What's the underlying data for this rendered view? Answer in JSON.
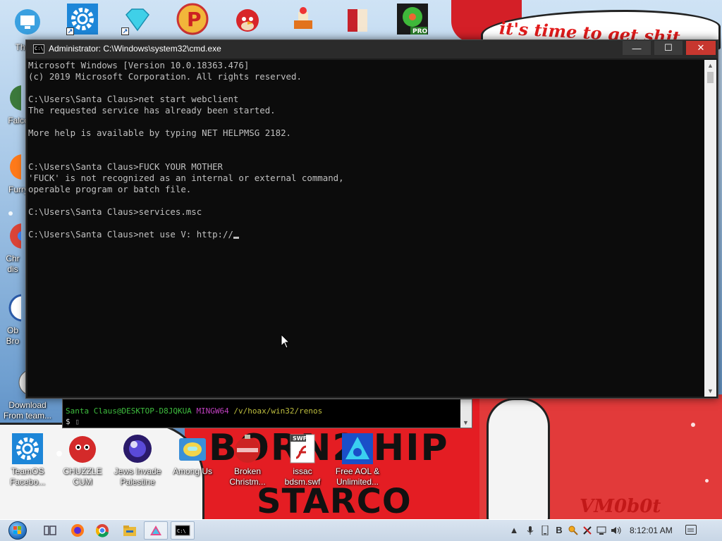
{
  "cmd_window": {
    "title": "Administrator: C:\\Windows\\system32\\cmd.exe",
    "icon_label": "C:\\",
    "lines": [
      "Microsoft Windows [Version 10.0.18363.476]",
      "(c) 2019 Microsoft Corporation. All rights reserved.",
      "",
      "C:\\Users\\Santa Claus>net start webclient",
      "The requested service has already been started.",
      "",
      "More help is available by typing NET HELPMSG 2182.",
      "",
      "",
      "C:\\Users\\Santa Claus>FUCK YOUR MOTHER",
      "'FUCK' is not recognized as an internal or external command,",
      "operable program or batch file.",
      "",
      "C:\\Users\\Santa Claus>services.msc",
      ""
    ],
    "current_input": "C:\\Users\\Santa Claus>net use V: http://",
    "buttons": {
      "minimize": "—",
      "maximize": "☐",
      "close": "✕"
    }
  },
  "git_bash": {
    "user_host": "Santa Claus@DESKTOP-D8JQKUA",
    "env": "MINGW64",
    "path": "/v/hoax/win32/renos",
    "prompt": "$"
  },
  "desktop_icons_left": [
    {
      "label": "Thi",
      "icon": "monitor-icon"
    },
    {
      "label": "Falco",
      "icon": "falcon-icon"
    },
    {
      "label": "Furry",
      "icon": "firefox-icon"
    },
    {
      "label": "Chr dis",
      "icon": "chrome-icon"
    },
    {
      "label": "Ob Bro",
      "icon": "obama-icon"
    },
    {
      "label": "Download From team...",
      "icon": "download-icon"
    }
  ],
  "desktop_icons_top": [
    {
      "icon": "gear-icon"
    },
    {
      "icon": "diamond-icon"
    },
    {
      "icon": "pinball-icon"
    },
    {
      "icon": "angry-bird-icon"
    },
    {
      "icon": "santa-ship-icon"
    },
    {
      "icon": "christmas-card-icon"
    },
    {
      "icon": "icq-flower-icon",
      "badge": "PRO"
    }
  ],
  "desktop_icons_bottom": [
    {
      "label": "TeamOS Facebo...",
      "icon": "gear-icon"
    },
    {
      "label": "CHUZZLE CUM",
      "icon": "chuzzle-icon"
    },
    {
      "label": "Jews Invade Palestine",
      "icon": "orb-icon"
    },
    {
      "label": "Among Us",
      "icon": "among-us-icon"
    },
    {
      "label": "Broken Christm...",
      "icon": "ornament-icon"
    },
    {
      "label": "issac bdsm.swf",
      "icon": "swf-file-icon",
      "badge": "SWF"
    },
    {
      "label": "Free AOL & Unlimited...",
      "icon": "aol-icon"
    }
  ],
  "wallpaper": {
    "speech": "it's time to get shit",
    "text_born": "BORN2 HIP",
    "text_starco": "STARCO",
    "signature": "VM0b0t"
  },
  "taskbar": {
    "apps": [
      "task-view-icon",
      "firefox-icon",
      "chrome-icon",
      "file-explorer-icon",
      "app-icon",
      "cmd-icon"
    ],
    "tray": [
      "chevron-up-icon",
      "microphone-icon",
      "mobile-icon",
      "b-icon",
      "search-icon",
      "tool-icon",
      "network-icon",
      "volume-icon"
    ],
    "clock": "8:12:01 AM"
  },
  "colors": {
    "console_bg": "#0c0c0c",
    "console_fg": "#c0c0c0",
    "close_red": "#c7372f",
    "bash_green": "#3fbf3f",
    "bash_purple": "#bf40bf",
    "bash_yellow": "#bfbf3f"
  }
}
